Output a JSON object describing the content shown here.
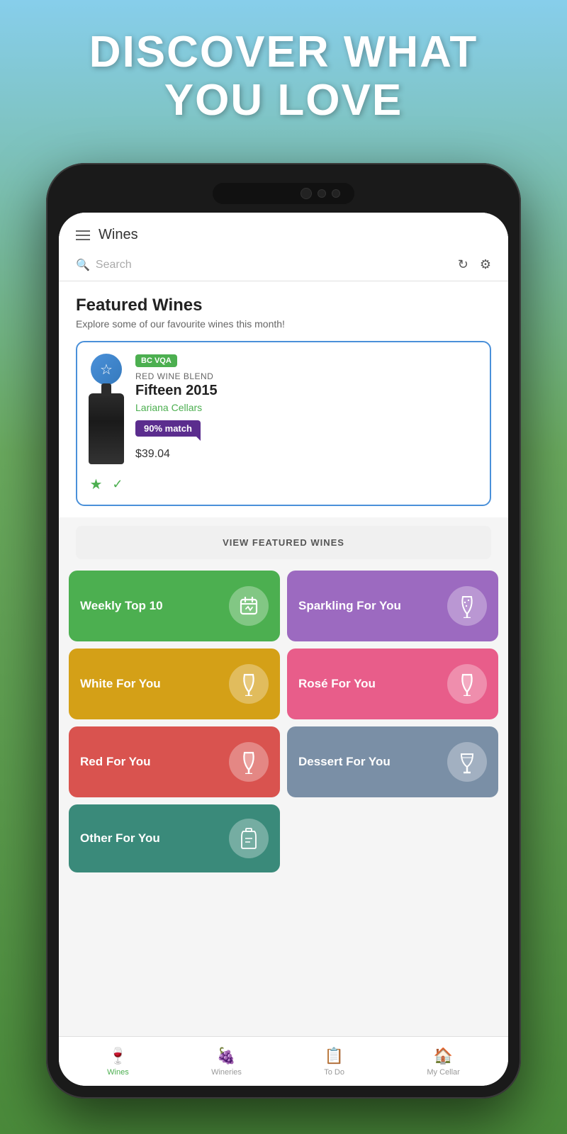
{
  "hero": {
    "line1": "DISCOVER WHAT",
    "line2": "YOU LOVE"
  },
  "app": {
    "header": {
      "title": "Wines"
    },
    "search": {
      "placeholder": "Search",
      "refresh_icon": "↻",
      "filter_icon": "⚙"
    },
    "featured": {
      "title": "Featured Wines",
      "subtitle": "Explore some of our favourite wines this month!",
      "wine": {
        "badge": "BC VQA",
        "type": "RED WINE BLEND",
        "name": "Fifteen 2015",
        "winery": "Lariana Cellars",
        "match": "90% match",
        "price": "$39.04"
      },
      "view_button": "VIEW FEATURED WINES"
    },
    "categories": [
      {
        "id": "weekly-top-10",
        "label": "Weekly Top 10",
        "color": "green",
        "icon": "📅"
      },
      {
        "id": "sparkling-for-you",
        "label": "Sparkling For You",
        "color": "purple",
        "icon": "🍷"
      },
      {
        "id": "white-for-you",
        "label": "White For You",
        "color": "yellow",
        "icon": "🍷"
      },
      {
        "id": "rose-for-you",
        "label": "Rosé For You",
        "color": "pink",
        "icon": "🍷"
      },
      {
        "id": "red-for-you",
        "label": "Red For You",
        "color": "red",
        "icon": "🍷"
      },
      {
        "id": "dessert-for-you",
        "label": "Dessert For You",
        "color": "slate",
        "icon": "🥂"
      },
      {
        "id": "other-for-you",
        "label": "Other For You",
        "color": "teal",
        "icon": "🍾"
      }
    ],
    "bottom_nav": [
      {
        "id": "wines",
        "label": "Wines",
        "icon": "🍷",
        "active": true
      },
      {
        "id": "wineries",
        "label": "Wineries",
        "icon": "🍇",
        "active": false
      },
      {
        "id": "todo",
        "label": "To Do",
        "icon": "📋",
        "active": false
      },
      {
        "id": "my-cellar",
        "label": "My Cellar",
        "icon": "🏠",
        "active": false
      }
    ]
  }
}
